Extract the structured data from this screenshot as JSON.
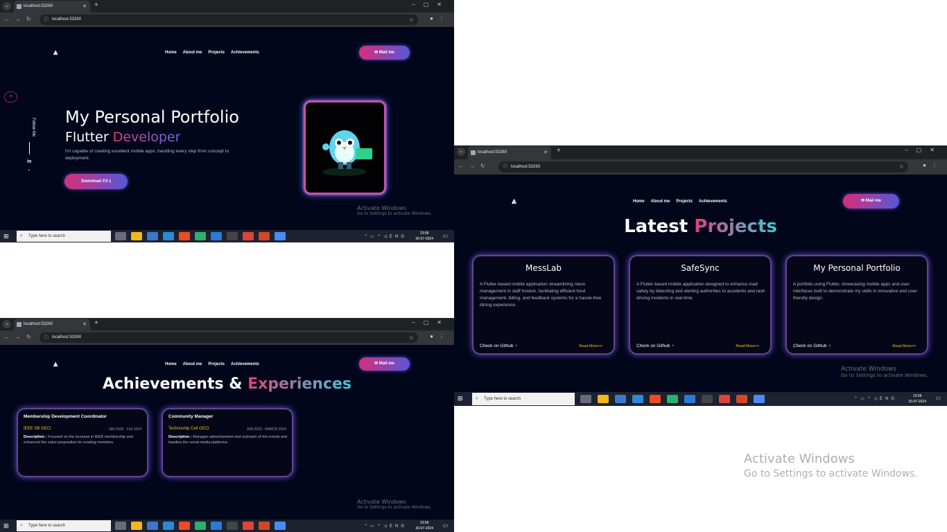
{
  "browser": {
    "tab_title": "localhost:53260",
    "url": "localhost:53260"
  },
  "site": {
    "logo": "⩓",
    "nav": [
      "Home",
      "About me",
      "Projects",
      "Achievements"
    ],
    "mail_button": "✉ Mail me"
  },
  "hero": {
    "title": "My Personal Portfolio",
    "subtitle_prefix": "Flutter",
    "subtitle_highlight": "Developer",
    "description": "I'm capable of creating excellent mobile apps, handling every step from concept to deployment.",
    "download_button": "Download CV ⭳",
    "follow_me": "Follow Me"
  },
  "projects": {
    "title_prefix": "Latest",
    "title_highlight": "Projects",
    "items": [
      {
        "name": "MessLab",
        "description": "A Flutter-based mobile application streamlining mess management in staff hostels, facilitating efficient food management, billing, and feedback systems for a hassle-free dining experience.",
        "github": "Check on Github",
        "more": "Read More>>"
      },
      {
        "name": "SafeSync",
        "description": "A Flutter-based mobile application designed to enhance road safety by detecting and alerting authorities to accidents and rash driving incidents in real-time.",
        "github": "Check on Github",
        "more": "Read More>>"
      },
      {
        "name": "My Personal Portfolio",
        "description": "A portfolio using Flutter, showcasing mobile apps and user interfaces built to demonstrate my skills in innovative and user-friendly design.",
        "github": "Check on Github",
        "more": "Read More>>"
      }
    ]
  },
  "achievements": {
    "title_prefix": "Achievements &",
    "title_highlight": "Experiences",
    "items": [
      {
        "role": "Membership Development Coordinator",
        "org": "IEEE SB GECI",
        "dates": "JAN 2023 - Feb 2024",
        "desc_label": "Description :",
        "description": "Focused on the increase in IEEE membership and enhanced the value proposition for existing members."
      },
      {
        "role": "Community Manager",
        "org": "Technoship Cell GECI",
        "dates": "JAN 2023 - MARCH 2024",
        "desc_label": "Description :",
        "description": "Manages advertisement and outreach of the events and handles the social media platforms."
      }
    ]
  },
  "taskbar": {
    "search_placeholder": "Type here to search",
    "lang": "ENG",
    "time": "23:58",
    "date": "30-07-2024"
  },
  "watermark": {
    "line1": "Activate Windows",
    "line2": "Go to Settings to activate Windows."
  },
  "colors": {
    "accent_pink": "#e0407e",
    "accent_purple": "#6b6bf0",
    "accent_cyan": "#3fc9d8",
    "gold": "#f2c21b",
    "background": "#02061a"
  }
}
